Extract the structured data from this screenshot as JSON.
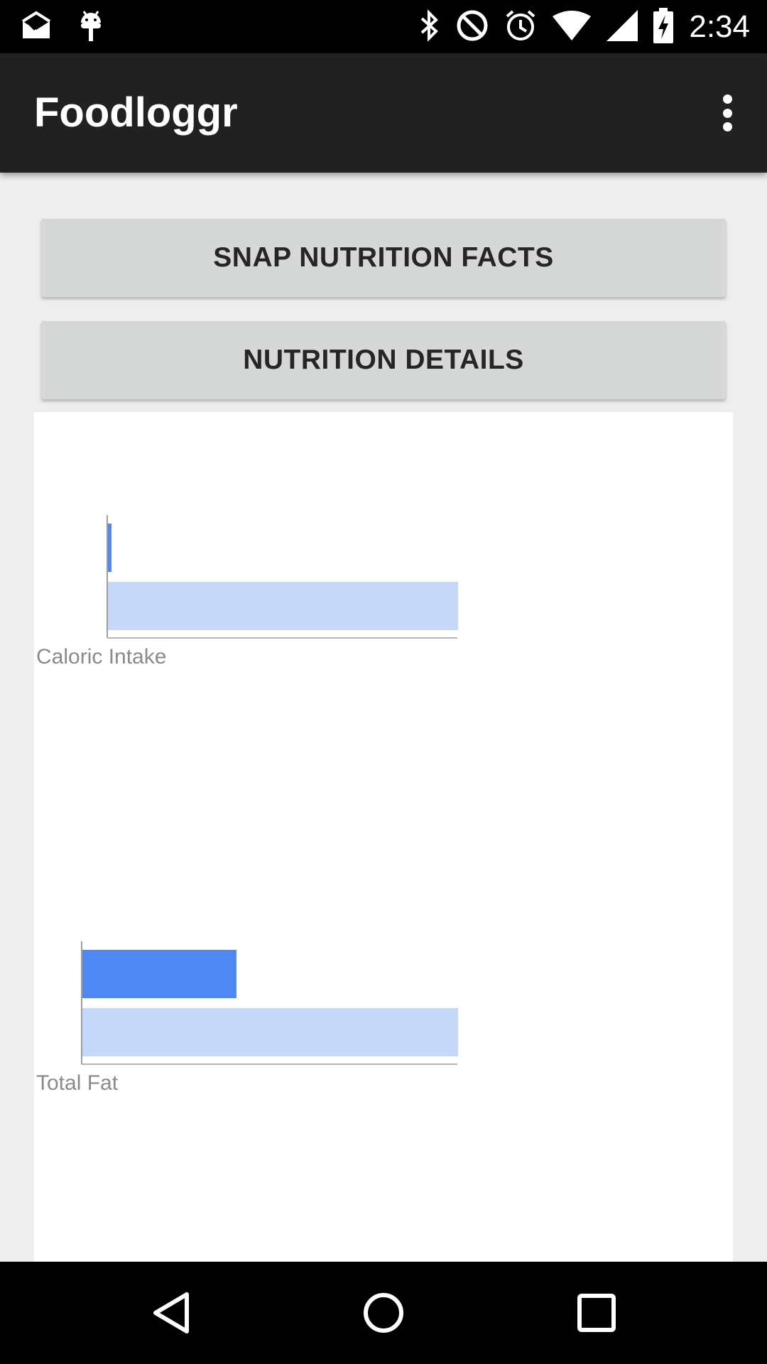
{
  "status_bar": {
    "time": "2:34",
    "left_icons": [
      "mail-check-icon",
      "android-debug-icon"
    ],
    "right_icons": [
      "bluetooth-icon",
      "do-not-disturb-icon",
      "alarm-icon",
      "wifi-icon",
      "cellular-signal-icon",
      "battery-charging-icon"
    ]
  },
  "app_bar": {
    "title": "Foodloggr",
    "overflow_icon": "more-vert-icon"
  },
  "buttons": {
    "snap_label": "SNAP NUTRITION FACTS",
    "details_label": "NUTRITION DETAILS"
  },
  "chart_data": [
    {
      "type": "bar",
      "orientation": "horizontal",
      "category": "Caloric Intake",
      "series": [
        {
          "role": "consumed",
          "value": 1,
          "color": "#4f87f3"
        },
        {
          "role": "goal",
          "value": 100,
          "color": "#c5d8f9"
        }
      ]
    },
    {
      "type": "bar",
      "orientation": "horizontal",
      "category": "Total Fat",
      "series": [
        {
          "role": "consumed",
          "value": 41,
          "color": "#4f87f3"
        },
        {
          "role": "goal",
          "value": 100,
          "color": "#c5d8f9"
        }
      ]
    }
  ],
  "nav_bar": {
    "icons": [
      "back-icon",
      "home-icon",
      "recents-icon"
    ]
  },
  "colors": {
    "status_bar": "#000000",
    "app_bar": "#212121",
    "background": "#eeeeee",
    "button": "#d6d7d7",
    "bar_consumed": "#4f87f3",
    "bar_goal": "#c5d8f9"
  }
}
